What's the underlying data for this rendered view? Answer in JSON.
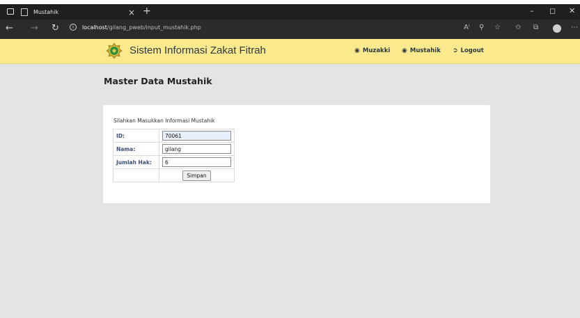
{
  "browser": {
    "tab_title": "Mustahik",
    "tab_close": "×",
    "new_tab": "+",
    "url_host": "localhost",
    "url_path": "/gilang_pweb/input_mustahik.php",
    "icons": [
      "tab-actions-icon",
      "back-icon",
      "forward-icon",
      "refresh-icon",
      "info-icon",
      "read-aloud-icon",
      "zoom-icon",
      "add-favorite-icon",
      "favorites-icon",
      "collections-icon",
      "profile-icon",
      "more-icon",
      "minimize-icon",
      "restore-icon",
      "close-icon"
    ]
  },
  "nav": {
    "brand": "Sistem Informasi Zakat Fitrah",
    "links": [
      {
        "label": "Muzakki",
        "icon": "user-circle-icon"
      },
      {
        "label": "Mustahik",
        "icon": "user-circle-icon"
      },
      {
        "label": "Logout",
        "icon": "logout-icon"
      }
    ],
    "bg_color": "#fbe98e"
  },
  "main": {
    "title": "Master Data Mustahik",
    "intro": "Silahkan Masukkan Informasi Mustahik",
    "fields": [
      {
        "label": "ID:",
        "value": "70061"
      },
      {
        "label": "Nama:",
        "value": "gilang"
      },
      {
        "label": "Jumlah Hak:",
        "value": "6"
      }
    ],
    "submit_label": "Simpan"
  }
}
